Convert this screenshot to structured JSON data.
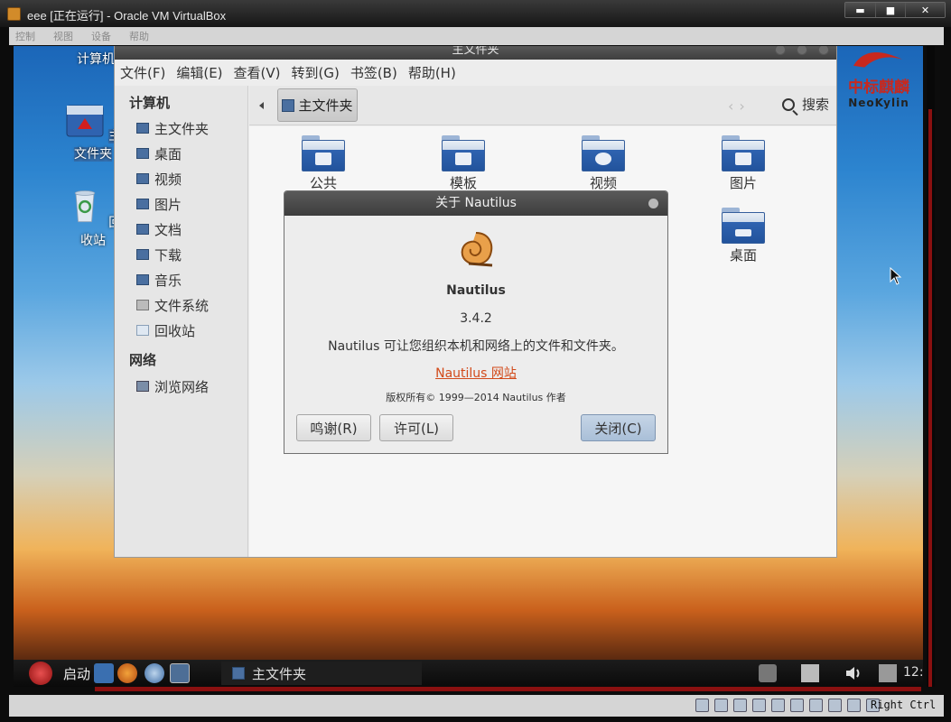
{
  "host": {
    "title": "eee [正在运行] - Oracle VM VirtualBox",
    "controls": [
      "▬",
      "■",
      "✕"
    ]
  },
  "vm_menu": [
    "控制",
    "视图",
    "设备",
    "帮助"
  ],
  "desktop": {
    "icons": [
      "计算机",
      "主文件夹",
      "回收站"
    ],
    "logo_cn": "中标麒麟",
    "logo_en": "NeoKylin"
  },
  "window": {
    "title": "主文件夹",
    "menu": [
      "文件(F)",
      "编辑(E)",
      "查看(V)",
      "转到(G)",
      "书签(B)",
      "帮助(H)"
    ],
    "sidebar": {
      "computer_header": "计算机",
      "computer_items": [
        "主文件夹",
        "桌面",
        "视频",
        "图片",
        "文档",
        "下载",
        "音乐",
        "文件系统",
        "回收站"
      ],
      "network_header": "网络",
      "network_items": [
        "浏览网络"
      ]
    },
    "toolbar": {
      "location": "主文件夹",
      "search": "搜索"
    },
    "folders": [
      "公共",
      "模板",
      "视频",
      "图片",
      "桌面"
    ]
  },
  "about": {
    "title": "关于  Nautilus",
    "app_name": "Nautilus",
    "version": "3.4.2",
    "description": "Nautilus 可让您组织本机和网络上的文件和文件夹。",
    "website": "Nautilus 网站",
    "copyright": "版权所有© 1999—2014  Nautilus 作者",
    "credits_button": "鸣谢(R)",
    "license_button": "许可(L)",
    "close_button": "关闭(C)",
    "link_color": "#d24a1a"
  },
  "taskbar": {
    "start": "启动",
    "task": "主文件夹",
    "clock": "12:"
  },
  "statusbar": {
    "hostkey": "Right Ctrl"
  }
}
